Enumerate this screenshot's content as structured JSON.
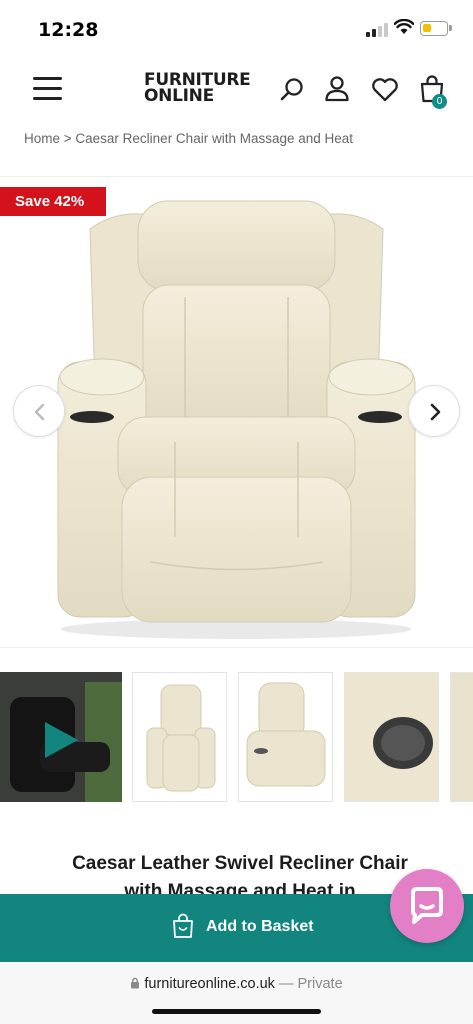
{
  "status_bar": {
    "time": "12:28"
  },
  "header": {
    "logo_line1": "FURNITURE",
    "logo_line2": "ONLINE",
    "basket_count": "0"
  },
  "breadcrumb": {
    "text": "Home > Caesar Recliner Chair with Massage and Heat"
  },
  "gallery": {
    "badge": "Save 42%",
    "thumbnail_count": 5
  },
  "product": {
    "title": "Caesar Leather Swivel Recliner Chair with Massage and Heat in"
  },
  "actions": {
    "add_to_basket": "Add to Basket"
  },
  "browser": {
    "domain": "furnitureonline.co.uk",
    "separator": " — ",
    "mode": "Private"
  },
  "colors": {
    "accent": "#12857f",
    "badge": "#d4121c",
    "chat": "#e37fc6",
    "chair": "#ede7d2"
  }
}
